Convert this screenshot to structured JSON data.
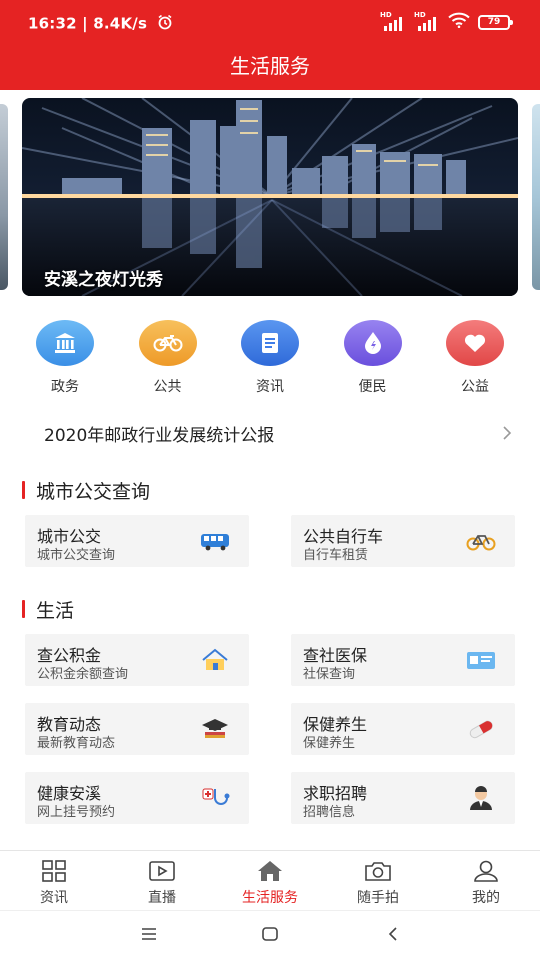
{
  "status": {
    "time_speed": "16:32 | 8.4K/s",
    "alarm_icon": "alarm-clock-icon",
    "hd_label": "HD",
    "battery": "79"
  },
  "header": {
    "title": "生活服务"
  },
  "banner": {
    "caption": "安溪之夜灯光秀"
  },
  "categories": [
    {
      "label": "政务",
      "icon": "government-building-icon",
      "color": "#4aa0ee"
    },
    {
      "label": "公共",
      "icon": "bicycle-icon",
      "color": "#f2a93b"
    },
    {
      "label": "资讯",
      "icon": "document-icon",
      "color": "#3f7de8"
    },
    {
      "label": "便民",
      "icon": "water-drop-icon",
      "color": "#7b62e6"
    },
    {
      "label": "公益",
      "icon": "heart-icon",
      "color": "#ec5a5a"
    }
  ],
  "notice": {
    "text": "2020年邮政行业发展统计公报"
  },
  "sections": {
    "bus": {
      "title": "城市公交查询",
      "cards": [
        {
          "title": "城市公交",
          "sub": "城市公交查询",
          "icon": "bus-icon"
        },
        {
          "title": "公共自行车",
          "sub": "自行车租赁",
          "icon": "bicycle-icon"
        }
      ]
    },
    "life": {
      "title": "生活",
      "cards": [
        {
          "title": "查公积金",
          "sub": "公积金余额查询",
          "icon": "house-fund-icon"
        },
        {
          "title": "查社医保",
          "sub": "社保查询",
          "icon": "insurance-card-icon"
        },
        {
          "title": "教育动态",
          "sub": "最新教育动态",
          "icon": "graduation-cap-icon"
        },
        {
          "title": "保健养生",
          "sub": "保健养生",
          "icon": "pill-capsule-icon"
        },
        {
          "title": "健康安溪",
          "sub": "网上挂号预约",
          "icon": "stethoscope-icon"
        },
        {
          "title": "求职招聘",
          "sub": "招聘信息",
          "icon": "job-seeker-icon"
        }
      ]
    }
  },
  "tabbar": {
    "items": [
      {
        "label": "资讯",
        "icon": "grid-icon"
      },
      {
        "label": "直播",
        "icon": "play-icon"
      },
      {
        "label": "生活服务",
        "icon": "home-icon"
      },
      {
        "label": "随手拍",
        "icon": "camera-icon"
      },
      {
        "label": "我的",
        "icon": "user-icon"
      }
    ],
    "active_index": 2
  },
  "navbar": {
    "icons": [
      "menu-icon",
      "home-square-icon",
      "back-icon"
    ]
  },
  "colors": {
    "brand": "#e52323",
    "tab_active": "#e52323",
    "card_bg": "#f4f4f4"
  }
}
